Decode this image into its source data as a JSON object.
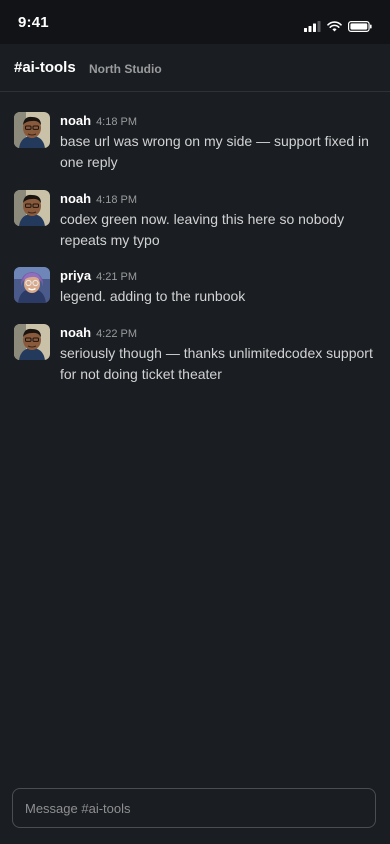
{
  "status_bar": {
    "time": "9:41"
  },
  "header": {
    "channel": "#ai-tools",
    "workspace": "North Studio"
  },
  "messages": [
    {
      "author": "noah",
      "time": "4:18 PM",
      "text": "base url was wrong on my side — support fixed in one reply",
      "avatar": "noah-avatar"
    },
    {
      "author": "noah",
      "time": "4:18 PM",
      "text": "codex green now. leaving this here so nobody repeats my typo",
      "avatar": "noah-avatar"
    },
    {
      "author": "priya",
      "time": "4:21 PM",
      "text": "legend. adding to the runbook",
      "avatar": "priya-avatar"
    },
    {
      "author": "noah",
      "time": "4:22 PM",
      "text": "seriously though — thanks unlimitedcodex support for not doing ticket theater",
      "avatar": "noah-avatar"
    }
  ],
  "composer": {
    "placeholder": "Message #ai-tools",
    "value": ""
  },
  "colors": {
    "background": "#1a1d21",
    "status_bar": "#121316",
    "divider": "#2e3136",
    "author": "#ffffff",
    "timestamp": "#9a9b9d",
    "message_text": "#d1d2d3",
    "composer_border": "#4a4d52"
  }
}
